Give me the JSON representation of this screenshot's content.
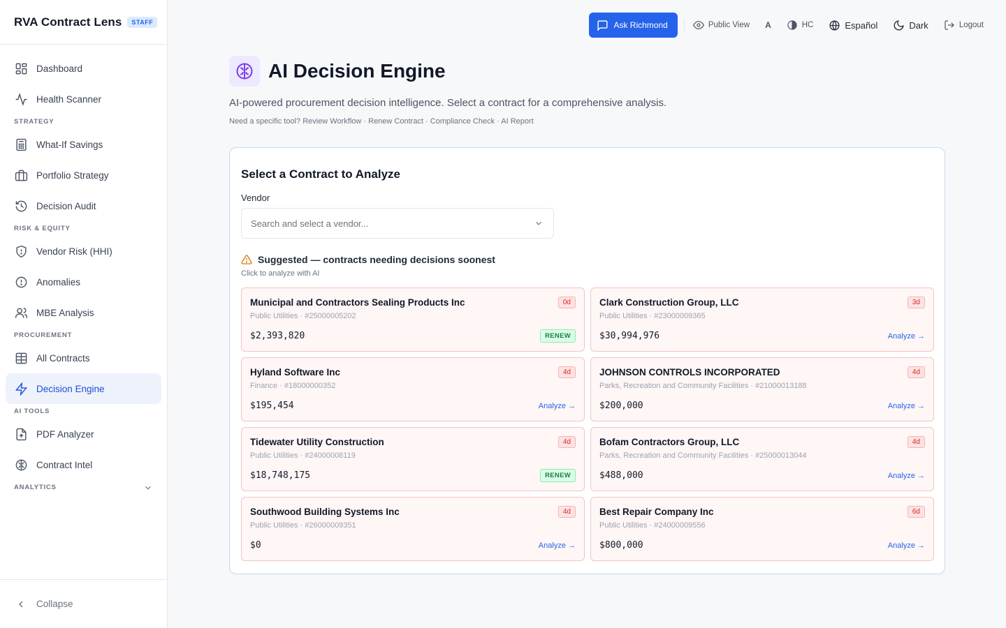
{
  "sidebar": {
    "brand": "RVA Contract Lens",
    "badge": "STAFF",
    "items": [
      {
        "label": "Dashboard"
      },
      {
        "label": "Health Scanner"
      },
      {
        "section": "STRATEGY"
      },
      {
        "label": "What-If Savings"
      },
      {
        "label": "Portfolio Strategy"
      },
      {
        "label": "Decision Audit"
      },
      {
        "section": "RISK & EQUITY"
      },
      {
        "label": "Vendor Risk (HHI)"
      },
      {
        "label": "Anomalies"
      },
      {
        "label": "MBE Analysis"
      },
      {
        "section": "PROCUREMENT"
      },
      {
        "label": "All Contracts"
      },
      {
        "label": "Decision Engine"
      },
      {
        "section": "AI TOOLS"
      },
      {
        "label": "PDF Analyzer"
      },
      {
        "label": "Contract Intel"
      },
      {
        "section": "ANALYTICS"
      }
    ],
    "collapse_label": "Collapse"
  },
  "topbar": {
    "ask": "Ask Richmond",
    "public_view": "Public View",
    "font_size": "A",
    "contrast": "HC",
    "language": "Español",
    "theme": "Dark",
    "logout": "Logout"
  },
  "page": {
    "title": "AI Decision Engine",
    "subtitle": "AI-powered procurement decision intelligence. Select a contract for a comprehensive analysis.",
    "tools_prefix": "Need a specific tool?",
    "tools": [
      "Review Workflow",
      "Renew Contract",
      "Compliance Check",
      "AI Report"
    ]
  },
  "selector": {
    "title": "Select a Contract to Analyze",
    "vendor_label": "Vendor",
    "vendor_placeholder": "Search and select a vendor...",
    "suggest_title": "Suggested — contracts needing decisions soonest",
    "suggest_sub": "Click to analyze with AI"
  },
  "contracts": [
    {
      "vendor": "Municipal and Contractors Sealing Products Inc",
      "meta": "Public Utilities · #25000005202",
      "value": "$2,393,820",
      "days": "0d",
      "action": "RENEW"
    },
    {
      "vendor": "Clark Construction Group, LLC",
      "meta": "Public Utilities · #23000009365",
      "value": "$30,994,976",
      "days": "3d",
      "action": "Analyze →"
    },
    {
      "vendor": "Hyland Software Inc",
      "meta": "Finance · #18000000352",
      "value": "$195,454",
      "days": "4d",
      "action": "Analyze →"
    },
    {
      "vendor": "JOHNSON CONTROLS INCORPORATED",
      "meta": "Parks, Recreation and Community Facilities · #21000013188",
      "value": "$200,000",
      "days": "4d",
      "action": "Analyze →"
    },
    {
      "vendor": "Tidewater Utility Construction",
      "meta": "Public Utilities · #24000008119",
      "value": "$18,748,175",
      "days": "4d",
      "action": "RENEW"
    },
    {
      "vendor": "Bofam Contractors Group, LLC",
      "meta": "Parks, Recreation and Community Facilities · #25000013044",
      "value": "$488,000",
      "days": "4d",
      "action": "Analyze →"
    },
    {
      "vendor": "Southwood Building Systems Inc",
      "meta": "Public Utilities · #26000009351",
      "value": "$0",
      "days": "4d",
      "action": "Analyze →"
    },
    {
      "vendor": "Best Repair Company Inc",
      "meta": "Public Utilities · #24000009556",
      "value": "$800,000",
      "days": "6d",
      "action": "Analyze →"
    }
  ],
  "colors": {
    "accent": "#2563eb",
    "active_bg": "#eef2fb",
    "card_bg": "#fff6f6",
    "card_border": "#f4c4c4",
    "urgent": "#dc2626",
    "renew": "#15803d",
    "title_icon_bg": "#ede9fe"
  }
}
